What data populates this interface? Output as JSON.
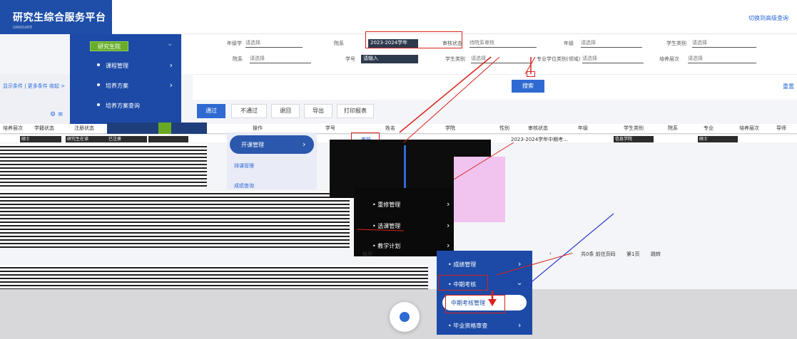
{
  "header": {
    "title": "研究生综合服务平台",
    "subtitle": "GRADUATE",
    "switch_link": "切换到高级查询"
  },
  "nav": {
    "current": "研究生院",
    "items": [
      {
        "label": "课程管理"
      },
      {
        "label": "培养方案"
      },
      {
        "label": "培养方案查询"
      }
    ]
  },
  "filters": {
    "row1": [
      {
        "label": "年级学",
        "value": "请选择"
      },
      {
        "label": "院系",
        "value": "2023-2024学年"
      },
      {
        "label": "审核状态",
        "value": "待院系审核"
      },
      {
        "label": "年级",
        "value": "请选择"
      },
      {
        "label": "学生类别",
        "value": "请选择"
      }
    ],
    "row2": [
      {
        "label": "院系",
        "value": "请选择"
      },
      {
        "label": "学号",
        "value": "请输入"
      },
      {
        "label": "学生类别",
        "value": "请选择"
      },
      {
        "label": "专业学位类别(领域)",
        "value": "请选择"
      },
      {
        "label": "培养层次",
        "value": "请选择"
      }
    ]
  },
  "left_pane": {
    "crumb": "显示条件 | 更多条件   收起 >",
    "reset": "重置"
  },
  "search_button": "搜索",
  "actions": [
    "通过",
    "不通过",
    "退回",
    "导出",
    "打印报表"
  ],
  "table": {
    "columns_left": [
      "培养层次",
      "学籍状态",
      "注册状态"
    ],
    "columns_right": [
      "操作",
      "学号",
      "姓名",
      "学院",
      "性别",
      "审核状态",
      "年级",
      "学生类别",
      "院系",
      "专业",
      "培养层次",
      "导师"
    ],
    "row": {
      "col1": "硕士",
      "col2": "研究生在读",
      "col3": "已注册",
      "action": "审核",
      "term": "2023-2024学年中期考...",
      "dept": "信息学院",
      "level": "硕士"
    }
  },
  "menus": {
    "open_mgmt": "开课管理",
    "pill_sub1": "排课管理",
    "pill_sub2": "成绩查询",
    "menu2": [
      "重修管理",
      "选课管理",
      "教学计划"
    ],
    "menu3": [
      "成绩管理",
      "中期考核",
      "中期考核管理",
      "毕业资格审查"
    ]
  },
  "pager": {
    "prefix": "每页",
    "total": "共0条 前往页码",
    "page": "第1页",
    "jump": "跳转"
  },
  "colors": {
    "brand": "#1f4ea8",
    "accent": "#2e6ad1",
    "highlight": "#d9231c",
    "nav_selected": "#67ad2a"
  }
}
